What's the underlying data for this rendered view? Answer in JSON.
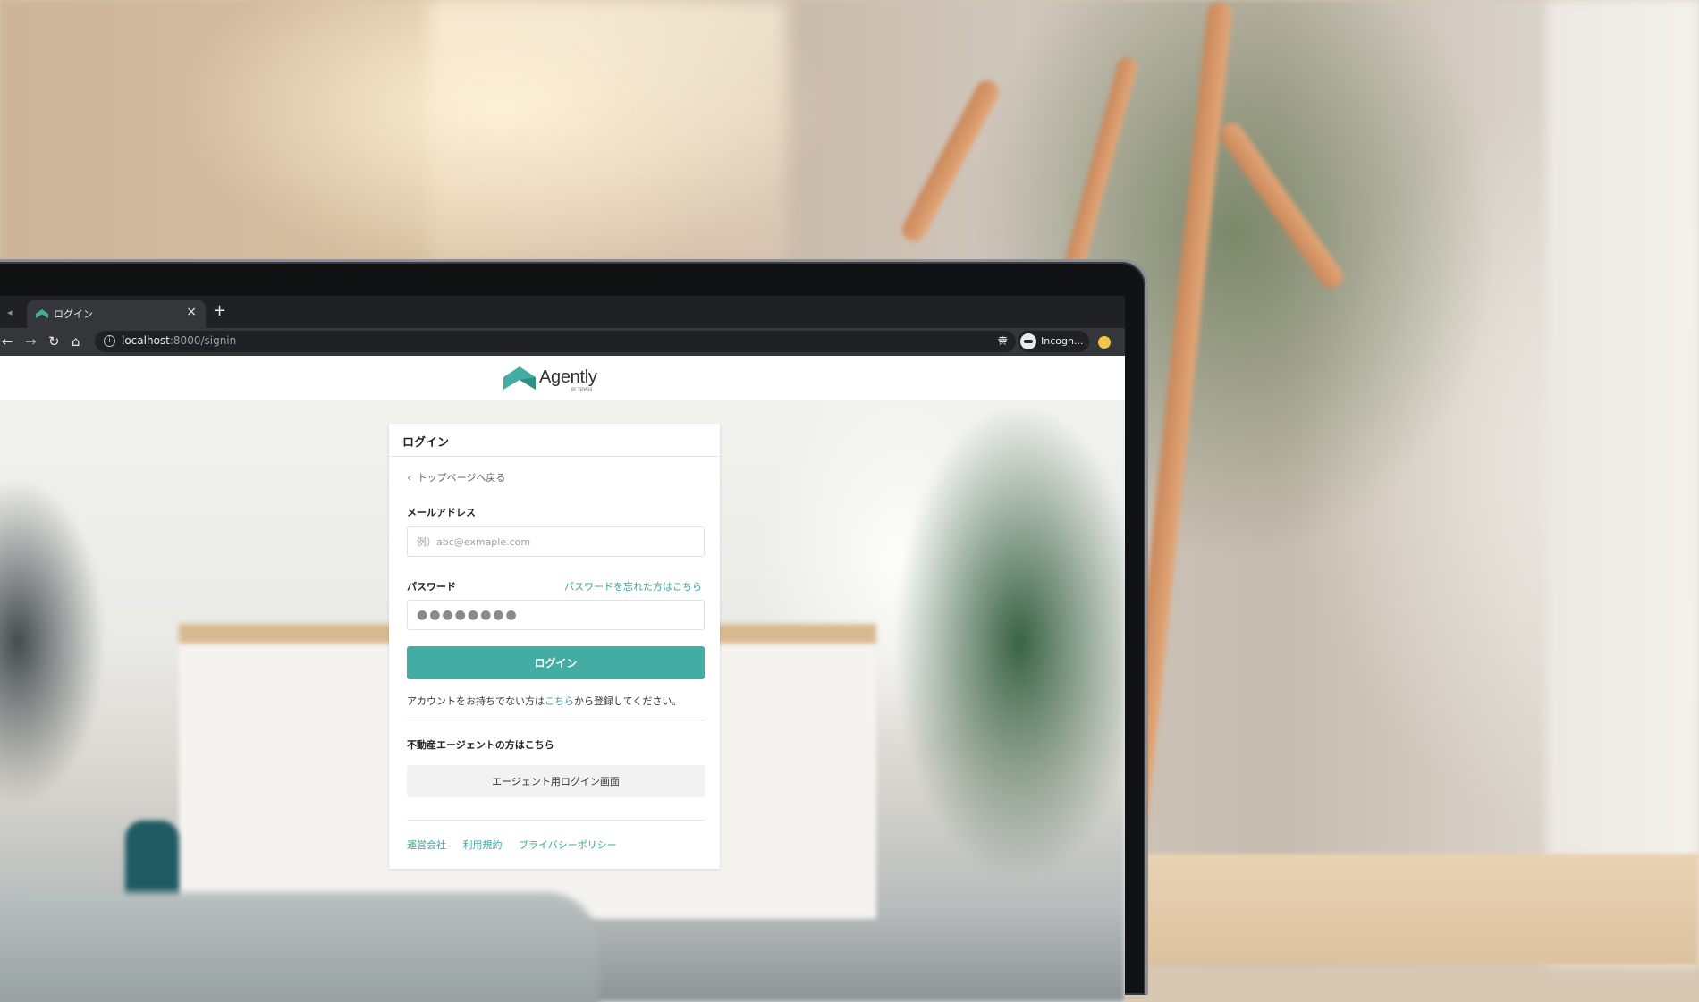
{
  "browser": {
    "tab_title": "ログイン",
    "url_host": "localhost",
    "url_rest": ":8000/signin",
    "incognito_label": "Incogn..."
  },
  "site": {
    "logo_text": "Agently",
    "logo_sub": "BY TERASS",
    "brand_color": "#43ada4"
  },
  "login": {
    "title": "ログイン",
    "back_link": "トップページへ戻る",
    "email_label": "メールアドレス",
    "email_placeholder": "例）abc@exmaple.com",
    "password_label": "パスワード",
    "forgot_password": "パスワードを忘れた方はこちら",
    "password_value": "●●●●●●●●",
    "submit": "ログイン",
    "register_prefix": "アカウントをお持ちでない方は",
    "register_link": "こちら",
    "register_suffix": "から登録してください。",
    "agent_title": "不動産エージェントの方はこちら",
    "agent_button": "エージェント用ログイン画面",
    "footer_links": [
      "運営会社",
      "利用規約",
      "プライバシーポリシー"
    ]
  }
}
